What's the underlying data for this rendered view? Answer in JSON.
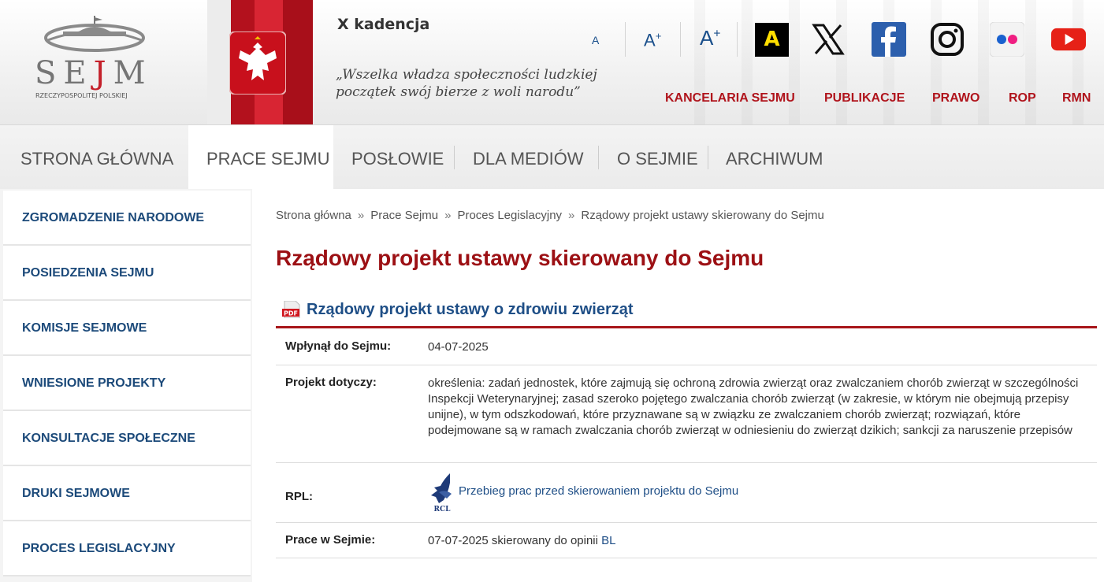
{
  "header": {
    "logo_text_left": "SE",
    "logo_text_red": "J",
    "logo_text_right": "M",
    "logo_sub": "RZECZYPOSPOLITEJ POLSKIEJ",
    "kadencja": "X kadencja",
    "motto_line1": "„Wszelka władza społeczności ludzkiej",
    "motto_line2": "początek swój bierze z woli narodu”",
    "font_small": "A",
    "font_medium": "A+",
    "font_large": "A+",
    "contrast": "A",
    "social": [
      "x-icon",
      "facebook-icon",
      "instagram-icon",
      "flickr-icon",
      "youtube-icon"
    ],
    "top_links": [
      "KANCELARIA SEJMU",
      "PUBLIKACJE",
      "PRAWO",
      "ROP",
      "RMN"
    ]
  },
  "main_nav": [
    "STRONA GŁÓWNA",
    "PRACE SEJMU",
    "POSŁOWIE",
    "DLA MEDIÓW",
    "O SEJMIE",
    "ARCHIWUM"
  ],
  "sidebar": [
    "ZGROMADZENIE NARODOWE",
    "POSIEDZENIA SEJMU",
    "KOMISJE SEJMOWE",
    "WNIESIONE PROJEKTY",
    "KONSULTACJE SPOŁECZNE",
    "DRUKI SEJMOWE",
    "PROCES LEGISLACYJNY"
  ],
  "breadcrumb": [
    "Strona główna",
    "Prace Sejmu",
    "Proces Legislacyjny",
    "Rządowy projekt ustawy skierowany do Sejmu"
  ],
  "breadcrumb_sep": "»",
  "page_title": "Rządowy projekt ustawy skierowany do Sejmu",
  "project": {
    "pdf_label": "PDF",
    "title": "Rządowy projekt ustawy o zdrowiu zwierząt",
    "received_label": "Wpłynął do Sejmu:",
    "received_value": "04-07-2025",
    "concerns_label": "Projekt dotyczy:",
    "concerns_value": "określenia: zadań jednostek, które zajmują się ochroną zdrowia zwierząt oraz zwalczaniem chorób zwierząt w szczególności Inspekcji Weterynaryjnej; zasad szeroko pojętego zwalczania chorób zwierząt (w zakresie, w którym nie obejmują przepisy unijne), w tym odszkodowań, które przyznawane są w związku ze zwalczaniem chorób zwierząt; rozwiązań, które podejmowane są w ramach zwalczania chorób zwierząt w odniesieniu do zwierząt dzikich; sankcji za naruszenie przepisów",
    "rpl_label": "RPL:",
    "rcl_label": "RCL",
    "rpl_link": "Przebieg prac przed skierowaniem projektu do Sejmu",
    "work_label": "Prace w Sejmie:",
    "work_value": "07-07-2025 skierowany do opinii",
    "work_link": "BL"
  }
}
